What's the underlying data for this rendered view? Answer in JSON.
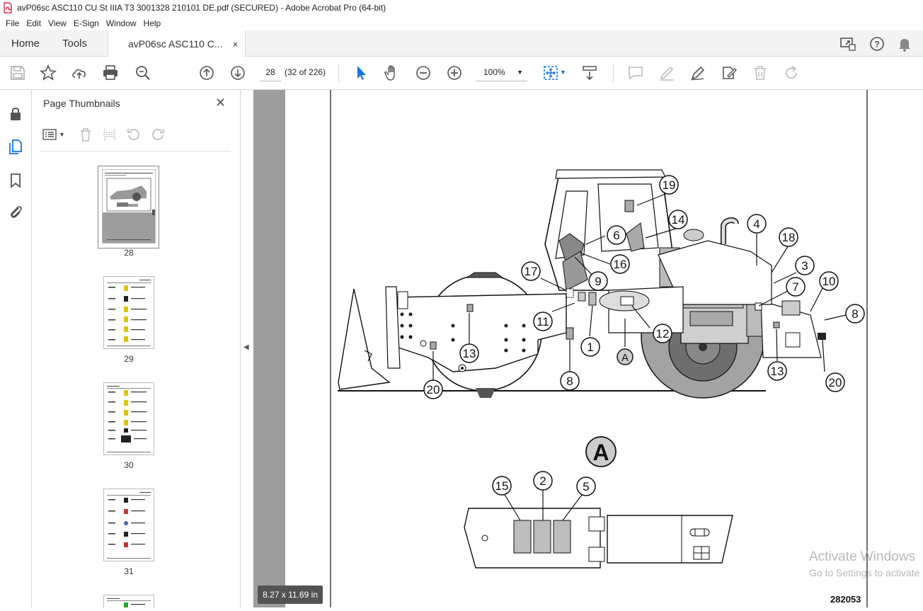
{
  "window": {
    "title": "avP06sc ASC110 CU St IIIA T3 3001328 210101 DE.pdf (SECURED) - Adobe Acrobat Pro (64-bit)"
  },
  "menu": [
    "File",
    "Edit",
    "View",
    "E-Sign",
    "Window",
    "Help"
  ],
  "tabs": {
    "home": "Home",
    "tools": "Tools",
    "doc": "avP06sc ASC110 C...",
    "close": "×"
  },
  "toolbar": {
    "page_number": "28",
    "page_count": "(32 of 226)",
    "zoom": "100%"
  },
  "thumb_panel": {
    "title": "Page Thumbnails",
    "close": "✕",
    "pages": [
      "28",
      "29",
      "30",
      "31"
    ]
  },
  "page": {
    "size": "8.27 x 11.69 in",
    "doc_number": "282053",
    "detail_letter": "A",
    "callouts_top": [
      "19",
      "14",
      "6",
      "16",
      "9",
      "17",
      "4",
      "18",
      "3",
      "7",
      "10",
      "8",
      "11",
      "1",
      "12",
      "13",
      "13",
      "8",
      "20",
      "20",
      "A"
    ],
    "callouts_detail": [
      "15",
      "2",
      "5"
    ]
  },
  "watermark": {
    "line1": "Activate Windows",
    "line2": "Go to Settings to activate"
  },
  "colors": {
    "accent": "#1473e6",
    "panel_gray": "#9d9d9d",
    "toolbar_bg": "#f3f3f3"
  }
}
